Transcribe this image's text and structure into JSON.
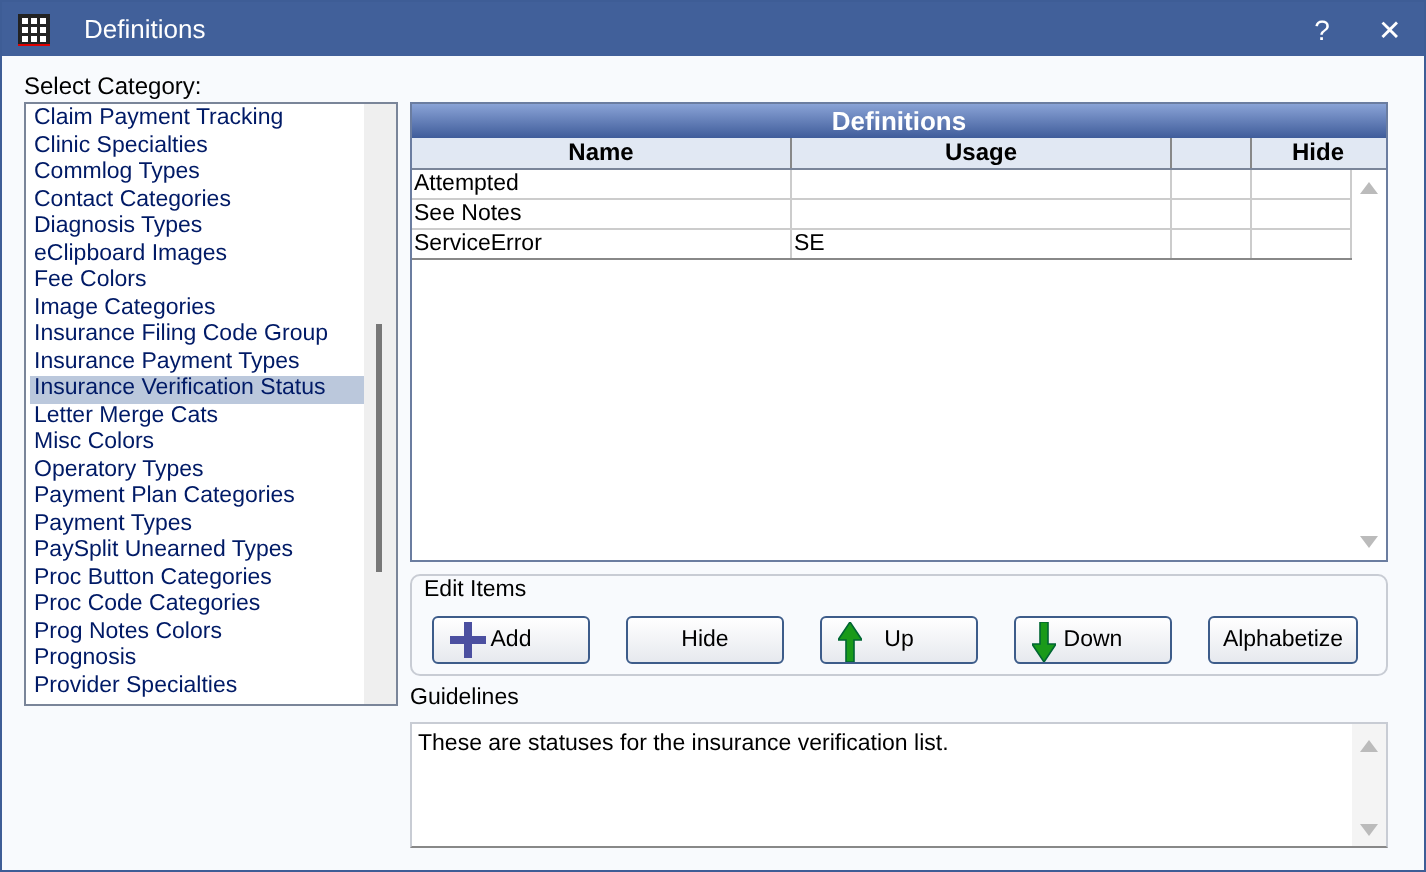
{
  "window": {
    "title": "Definitions",
    "buttons": [
      "?",
      "✕"
    ]
  },
  "category_label": "Select Category:",
  "categories": [
    {
      "label": "Claim Payment Tracking",
      "selected": false
    },
    {
      "label": "Clinic Specialties",
      "selected": false
    },
    {
      "label": "Commlog Types",
      "selected": false
    },
    {
      "label": "Contact Categories",
      "selected": false
    },
    {
      "label": "Diagnosis Types",
      "selected": false
    },
    {
      "label": "eClipboard Images",
      "selected": false
    },
    {
      "label": "Fee Colors",
      "selected": false
    },
    {
      "label": "Image Categories",
      "selected": false
    },
    {
      "label": "Insurance Filing Code Group",
      "selected": false
    },
    {
      "label": "Insurance Payment Types",
      "selected": false
    },
    {
      "label": "Insurance Verification Status",
      "selected": true
    },
    {
      "label": "Letter Merge Cats",
      "selected": false
    },
    {
      "label": "Misc Colors",
      "selected": false
    },
    {
      "label": "Operatory Types",
      "selected": false
    },
    {
      "label": "Payment Plan Categories",
      "selected": false
    },
    {
      "label": "Payment Types",
      "selected": false
    },
    {
      "label": "PaySplit Unearned Types",
      "selected": false
    },
    {
      "label": "Proc Button Categories",
      "selected": false
    },
    {
      "label": "Proc Code Categories",
      "selected": false
    },
    {
      "label": "Prog Notes Colors",
      "selected": false
    },
    {
      "label": "Prognosis",
      "selected": false
    },
    {
      "label": "Provider Specialties",
      "selected": false
    }
  ],
  "table": {
    "title": "Definitions",
    "columns": [
      "Name",
      "Usage",
      "",
      "Hide"
    ],
    "rows": [
      [
        "Attempted",
        "",
        "",
        ""
      ],
      [
        "See Notes",
        "",
        "",
        ""
      ],
      [
        "ServiceError",
        "SE",
        "",
        ""
      ]
    ]
  },
  "edit_items": {
    "label": "Edit Items",
    "buttons": [
      {
        "label": "Add",
        "kind": "plus"
      },
      {
        "label": "Hide",
        "kind": "plain"
      },
      {
        "label": "Up",
        "kind": "up"
      },
      {
        "label": "Down",
        "kind": "down"
      },
      {
        "label": "Alphabetize",
        "kind": "plain"
      }
    ]
  },
  "guidelines": {
    "label": "Guidelines",
    "text": "These are statuses for the insurance verification list."
  }
}
